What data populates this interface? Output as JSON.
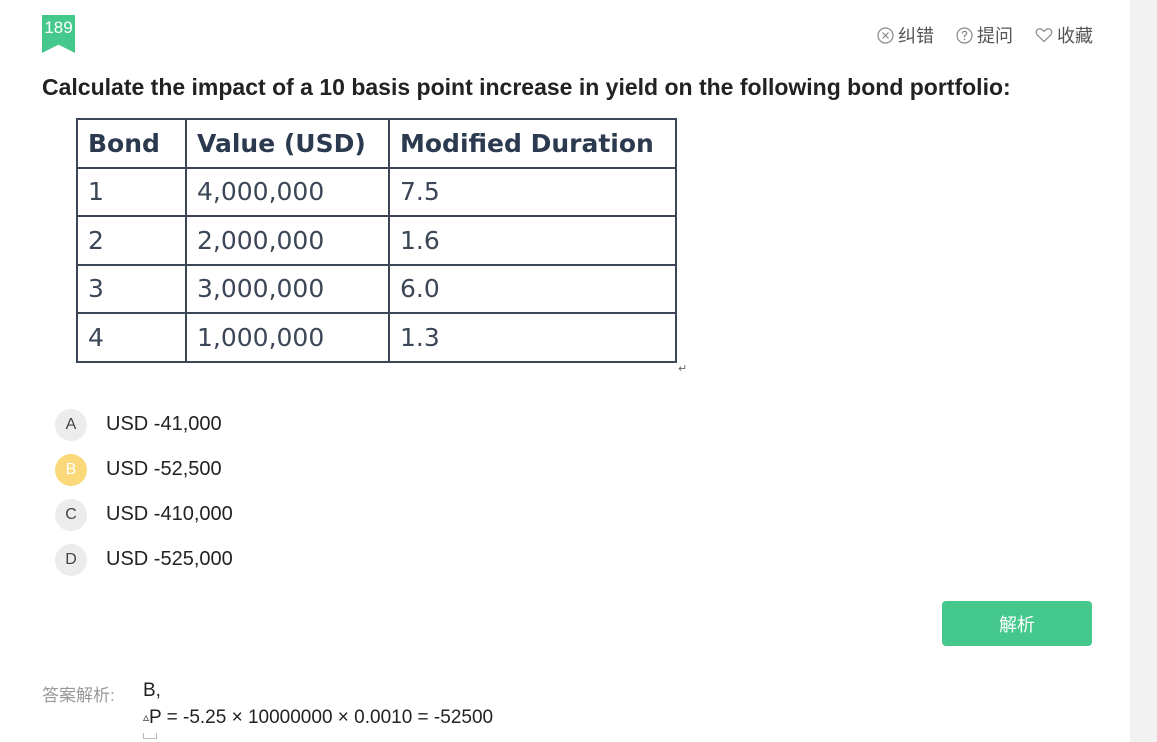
{
  "question_number": "189",
  "actions": {
    "report_error": "纠错",
    "ask": "提问",
    "favorite": "收藏"
  },
  "question_text": "Calculate the impact of a 10 basis point increase in yield on the following bond portfolio:",
  "table": {
    "headers": [
      "Bond",
      "Value (USD)",
      "Modified Duration"
    ],
    "rows": [
      [
        "1",
        "4,000,000",
        "7.5"
      ],
      [
        "2",
        "2,000,000",
        "1.6"
      ],
      [
        "3",
        "3,000,000",
        "6.0"
      ],
      [
        "4",
        "1,000,000",
        "1.3"
      ]
    ]
  },
  "return_mark": "↵",
  "options": [
    {
      "letter": "A",
      "text": "USD -41,000",
      "selected": false
    },
    {
      "letter": "B",
      "text": "USD -52,500",
      "selected": true
    },
    {
      "letter": "C",
      "text": "USD -410,000",
      "selected": false
    },
    {
      "letter": "D",
      "text": "USD -525,000",
      "selected": false
    }
  ],
  "analysis_button": "解析",
  "answer": {
    "label": "答案解析:",
    "choice": "B,",
    "triangle": "▵",
    "formula": "P = -5.25 × 10000000 × 0.0010 = -52500"
  },
  "colors": {
    "accent": "#44c88c",
    "selected_option": "#fbd97a",
    "table_border": "#3b4656"
  }
}
